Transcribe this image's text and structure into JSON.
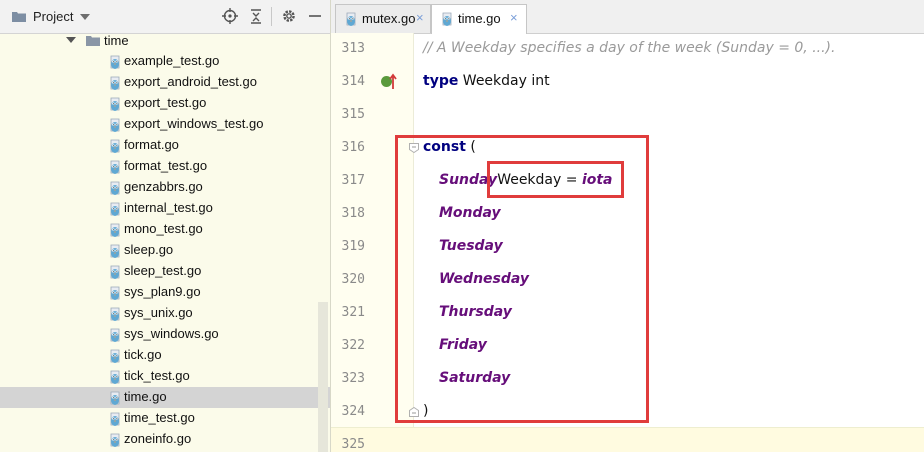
{
  "project_panel": {
    "title": "Project",
    "folder": "time",
    "files": [
      "example_test.go",
      "export_android_test.go",
      "export_test.go",
      "export_windows_test.go",
      "format.go",
      "format_test.go",
      "genzabbrs.go",
      "internal_test.go",
      "mono_test.go",
      "sleep.go",
      "sleep_test.go",
      "sys_plan9.go",
      "sys_unix.go",
      "sys_windows.go",
      "tick.go",
      "tick_test.go",
      "time.go",
      "time_test.go",
      "zoneinfo.go"
    ],
    "selected_file": "time.go"
  },
  "tabs": [
    {
      "label": "mutex.go",
      "close": "×"
    },
    {
      "label": "time.go",
      "close": "×"
    }
  ],
  "editor": {
    "lines": [
      {
        "num": "313",
        "comment": "// A Weekday specifies a day of the week (Sunday = 0, ...)."
      },
      {
        "num": "314",
        "kw": "type",
        "rest": " Weekday int"
      },
      {
        "num": "315"
      },
      {
        "num": "316",
        "kw": "const",
        "rest": " ("
      },
      {
        "num": "317",
        "name": "Sunday",
        "type_text": "Weekday = ",
        "iota": "iota"
      },
      {
        "num": "318",
        "name": "Monday"
      },
      {
        "num": "319",
        "name": "Tuesday"
      },
      {
        "num": "320",
        "name": "Wednesday"
      },
      {
        "num": "321",
        "name": "Thursday"
      },
      {
        "num": "322",
        "name": "Friday"
      },
      {
        "num": "323",
        "name": "Saturday"
      },
      {
        "num": "324",
        "rest": ")"
      },
      {
        "num": "325"
      }
    ]
  },
  "colors": {
    "keyword": "#000080",
    "constant": "#660e7a",
    "comment": "#9a9a9a",
    "highlight_box": "#e03c3c",
    "panel_background": "#fbfbea"
  }
}
